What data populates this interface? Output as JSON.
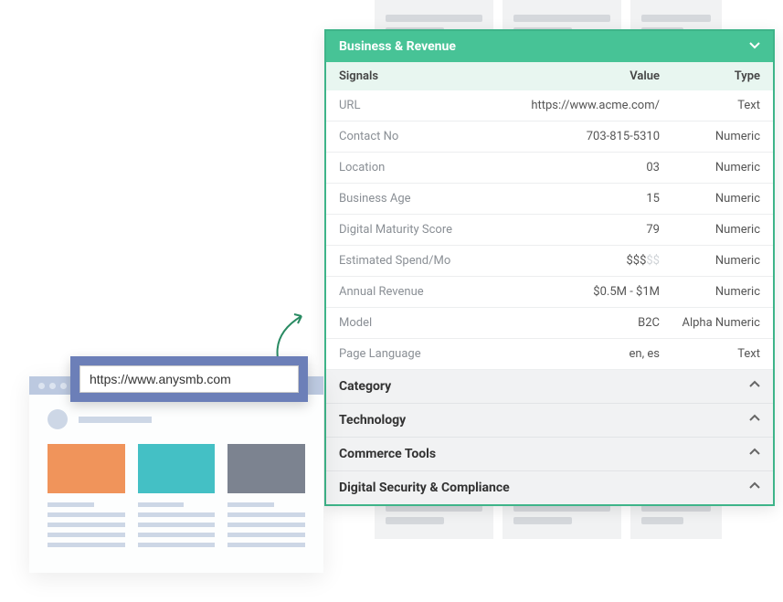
{
  "url_input": "https://www.anysmb.com",
  "panel": {
    "title": "Business & Revenue",
    "headers": {
      "signals": "Signals",
      "value": "Value",
      "type": "Type"
    },
    "rows": [
      {
        "signal": "URL",
        "value": "https://www.acme.com/",
        "type": "Text"
      },
      {
        "signal": "Contact No",
        "value": "703-815-5310",
        "type": "Numeric"
      },
      {
        "signal": "Location",
        "value": "03",
        "type": "Numeric"
      },
      {
        "signal": "Business Age",
        "value": "15",
        "type": "Numeric"
      },
      {
        "signal": "Digital Maturity Score",
        "value": "79",
        "type": "Numeric"
      },
      {
        "signal": "Estimated Spend/Mo",
        "value_on": "$$$",
        "value_off": "$$",
        "type": "Numeric"
      },
      {
        "signal": "Annual Revenue",
        "value": "$0.5M - $1M",
        "type": "Numeric"
      },
      {
        "signal": "Model",
        "value": "B2C",
        "type": "Alpha Numeric"
      },
      {
        "signal": "Page Language",
        "value": "en, es",
        "type": "Text"
      }
    ],
    "sections": [
      "Category",
      "Technology",
      "Commerce Tools",
      "Digital Security & Compliance"
    ]
  }
}
